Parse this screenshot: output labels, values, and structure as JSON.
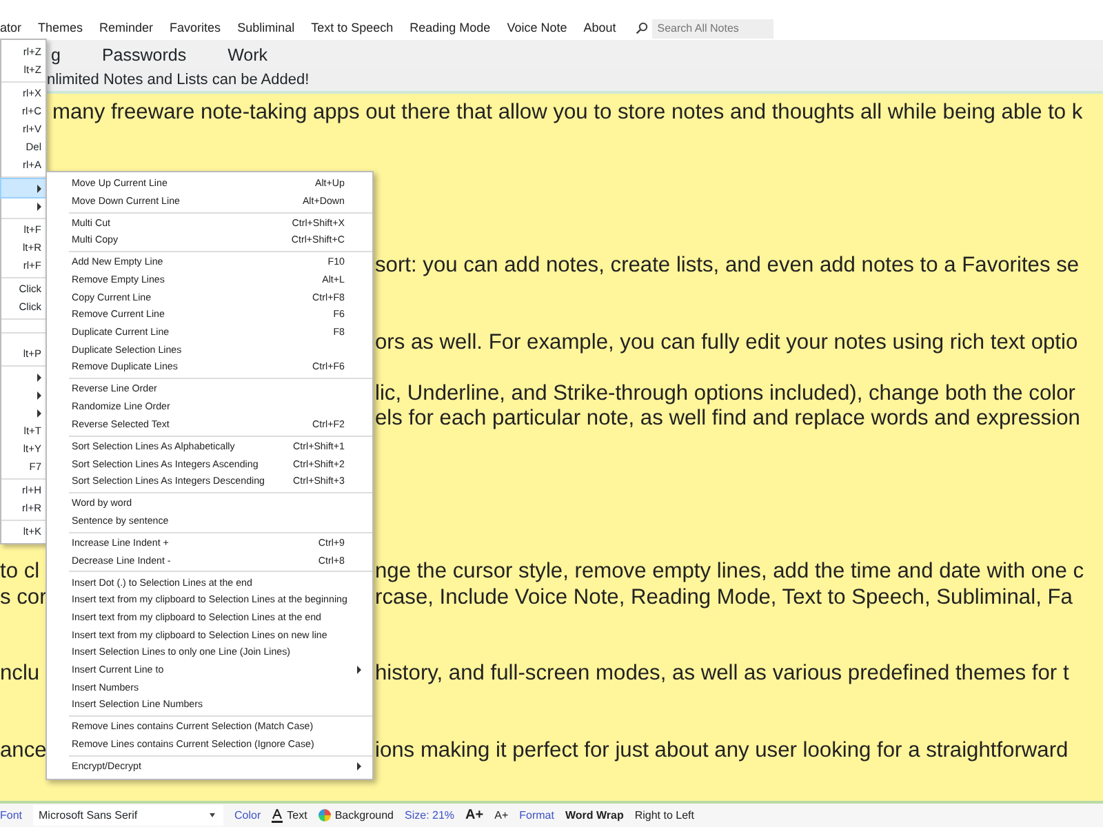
{
  "menubar": {
    "items": [
      "ator",
      "Themes",
      "Reminder",
      "Favorites",
      "Subliminal",
      "Text to Speech",
      "Reading Mode",
      "Voice Note",
      "About"
    ],
    "search": {
      "placeholder": "Search All Notes"
    }
  },
  "tabs": [
    {
      "label": "g",
      "selected": false
    },
    {
      "label": "Passwords",
      "selected": false
    },
    {
      "label": "Work",
      "selected": false
    }
  ],
  "note_title": "nlimited Notes and Lists can be Added!",
  "editor": {
    "lines": [
      {
        "right": "many freeware note-taking apps out there that allow you to store notes and thoughts all while being able to k"
      },
      {
        "right": "sort: you can add notes, create lists, and even add notes to a Favorites se"
      },
      {
        "right": "ors as well. For example, you can fully edit your notes using rich text optio"
      },
      {
        "right": "lic, Underline, and Strike-through options included), change both the color"
      },
      {
        "right": "els for each particular note, as well find and replace words and expression"
      },
      {
        "left": "to cl",
        "right": "nge the cursor style, remove empty lines, add the time and date with one c"
      },
      {
        "left": "s cor",
        "right": "rcase, Include Voice Note, Reading Mode, Text to Speech, Subliminal, Fa"
      },
      {
        "left": "nclu",
        "right": "history, and full-screen modes, as well as various predefined themes for t"
      },
      {
        "left": "ance",
        "right": "ions making it perfect for just about any user looking for a straightforward"
      }
    ]
  },
  "edit_menu": {
    "items": [
      {
        "kind": "item",
        "shortcut": "rl+Z",
        "submenu": false,
        "selected": false
      },
      {
        "kind": "item",
        "shortcut": "lt+Z",
        "submenu": false,
        "selected": false
      },
      {
        "kind": "separator"
      },
      {
        "kind": "item",
        "shortcut": "rl+X",
        "submenu": false,
        "selected": false
      },
      {
        "kind": "item",
        "shortcut": "rl+C",
        "submenu": false,
        "selected": false
      },
      {
        "kind": "item",
        "shortcut": "rl+V",
        "submenu": false,
        "selected": false
      },
      {
        "kind": "item",
        "shortcut": "Del",
        "submenu": false,
        "selected": false
      },
      {
        "kind": "item",
        "shortcut": "rl+A",
        "submenu": false,
        "selected": false
      },
      {
        "kind": "separator"
      },
      {
        "kind": "item",
        "submenu": true,
        "selected": true
      },
      {
        "kind": "item",
        "submenu": true,
        "selected": false
      },
      {
        "kind": "separator"
      },
      {
        "kind": "item",
        "shortcut": "lt+F",
        "submenu": false,
        "selected": false
      },
      {
        "kind": "item",
        "shortcut": "lt+R",
        "submenu": false,
        "selected": false
      },
      {
        "kind": "item",
        "shortcut": "rl+F",
        "submenu": false,
        "selected": false
      },
      {
        "kind": "separator"
      },
      {
        "kind": "item",
        "shortcut": "Click",
        "submenu": false,
        "selected": false
      },
      {
        "kind": "item",
        "shortcut": "Click",
        "submenu": false,
        "selected": false
      },
      {
        "kind": "separator"
      },
      {
        "kind": "separator"
      },
      {
        "kind": "item",
        "shortcut": "lt+P",
        "submenu": false,
        "selected": false
      },
      {
        "kind": "separator"
      },
      {
        "kind": "item",
        "submenu": true,
        "selected": false
      },
      {
        "kind": "item",
        "submenu": true,
        "selected": false
      },
      {
        "kind": "item",
        "submenu": true,
        "selected": false
      },
      {
        "kind": "item",
        "shortcut": "lt+T",
        "submenu": false,
        "selected": false
      },
      {
        "kind": "item",
        "shortcut": "lt+Y",
        "submenu": false,
        "selected": false
      },
      {
        "kind": "item",
        "shortcut": "F7",
        "submenu": false,
        "selected": false
      },
      {
        "kind": "separator"
      },
      {
        "kind": "item",
        "shortcut": "rl+H",
        "submenu": false,
        "selected": false
      },
      {
        "kind": "item",
        "shortcut": "rl+R",
        "submenu": false,
        "selected": false
      },
      {
        "kind": "separator"
      },
      {
        "kind": "item",
        "shortcut": "lt+K",
        "submenu": false,
        "selected": false
      }
    ]
  },
  "submenu": {
    "items": [
      {
        "kind": "item",
        "label": "Move Up Current Line",
        "shortcut": "Alt+Up",
        "submenu": false
      },
      {
        "kind": "item",
        "label": "Move Down Current Line",
        "shortcut": "Alt+Down",
        "submenu": false
      },
      {
        "kind": "separator"
      },
      {
        "kind": "item",
        "label": "Multi Cut",
        "shortcut": "Ctrl+Shift+X",
        "submenu": false
      },
      {
        "kind": "item",
        "label": "Multi Copy",
        "shortcut": "Ctrl+Shift+C",
        "submenu": false
      },
      {
        "kind": "separator"
      },
      {
        "kind": "item",
        "label": "Add New Empty Line",
        "shortcut": "F10",
        "submenu": false
      },
      {
        "kind": "item",
        "label": "Remove Empty Lines",
        "shortcut": "Alt+L",
        "submenu": false
      },
      {
        "kind": "item",
        "label": "Copy Current Line",
        "shortcut": "Ctrl+F8",
        "submenu": false
      },
      {
        "kind": "item",
        "label": "Remove Current Line",
        "shortcut": "F6",
        "submenu": false
      },
      {
        "kind": "item",
        "label": "Duplicate Current Line",
        "shortcut": "F8",
        "submenu": false
      },
      {
        "kind": "item",
        "label": "Duplicate Selection Lines",
        "submenu": false
      },
      {
        "kind": "item",
        "label": "Remove Duplicate Lines",
        "shortcut": "Ctrl+F6",
        "submenu": false
      },
      {
        "kind": "separator"
      },
      {
        "kind": "item",
        "label": "Reverse Line Order",
        "submenu": false
      },
      {
        "kind": "item",
        "label": "Randomize Line Order",
        "submenu": false
      },
      {
        "kind": "item",
        "label": "Reverse Selected Text",
        "shortcut": "Ctrl+F2",
        "submenu": false
      },
      {
        "kind": "separator"
      },
      {
        "kind": "item",
        "label": "Sort Selection Lines As Alphabetically",
        "shortcut": "Ctrl+Shift+1",
        "submenu": false
      },
      {
        "kind": "item",
        "label": "Sort Selection Lines As Integers Ascending",
        "shortcut": "Ctrl+Shift+2",
        "submenu": false
      },
      {
        "kind": "item",
        "label": "Sort Selection Lines As Integers Descending",
        "shortcut": "Ctrl+Shift+3",
        "submenu": false
      },
      {
        "kind": "separator"
      },
      {
        "kind": "item",
        "label": "Word by word",
        "submenu": false
      },
      {
        "kind": "item",
        "label": "Sentence by sentence",
        "submenu": false
      },
      {
        "kind": "separator"
      },
      {
        "kind": "item",
        "label": "Increase Line Indent +",
        "shortcut": "Ctrl+9",
        "submenu": false
      },
      {
        "kind": "item",
        "label": "Decrease Line Indent -",
        "shortcut": "Ctrl+8",
        "submenu": false
      },
      {
        "kind": "separator"
      },
      {
        "kind": "item",
        "label": "Insert Dot (.) to Selection Lines at the end",
        "submenu": false
      },
      {
        "kind": "item",
        "label": "Insert text from my clipboard to Selection Lines at the beginning",
        "submenu": false
      },
      {
        "kind": "item",
        "label": "Insert text from my clipboard to Selection Lines at the end",
        "submenu": false
      },
      {
        "kind": "item",
        "label": "Insert text from my clipboard to Selection Lines on new line",
        "submenu": false
      },
      {
        "kind": "item",
        "label": "Insert Selection Lines to only one Line (Join Lines)",
        "submenu": false
      },
      {
        "kind": "item",
        "label": "Insert Current Line to",
        "submenu": true
      },
      {
        "kind": "item",
        "label": "Insert Numbers",
        "submenu": false
      },
      {
        "kind": "item",
        "label": "Insert Selection Line Numbers",
        "submenu": false
      },
      {
        "kind": "separator"
      },
      {
        "kind": "item",
        "label": "Remove Lines contains Current Selection (Match Case)",
        "submenu": false
      },
      {
        "kind": "item",
        "label": "Remove Lines contains Current Selection (Ignore Case)",
        "submenu": false
      },
      {
        "kind": "separator"
      },
      {
        "kind": "item",
        "label": "Encrypt/Decrypt",
        "submenu": true
      }
    ]
  },
  "toolbar": [
    {
      "kind": "label",
      "text": "Font"
    },
    {
      "kind": "select",
      "value": "Microsoft Sans Serif"
    },
    {
      "kind": "label",
      "text": "Color"
    },
    {
      "kind": "text-color",
      "text": "Text"
    },
    {
      "kind": "background-color",
      "text": "Background"
    },
    {
      "kind": "label",
      "text": "Size: 21%"
    },
    {
      "kind": "grow",
      "text": "A+"
    },
    {
      "kind": "shrink",
      "text": "A+"
    },
    {
      "kind": "label",
      "text": "Format"
    },
    {
      "kind": "toggle",
      "text": "Word Wrap",
      "on": true
    },
    {
      "kind": "toggle",
      "text": "Right to Left",
      "on": false
    }
  ]
}
